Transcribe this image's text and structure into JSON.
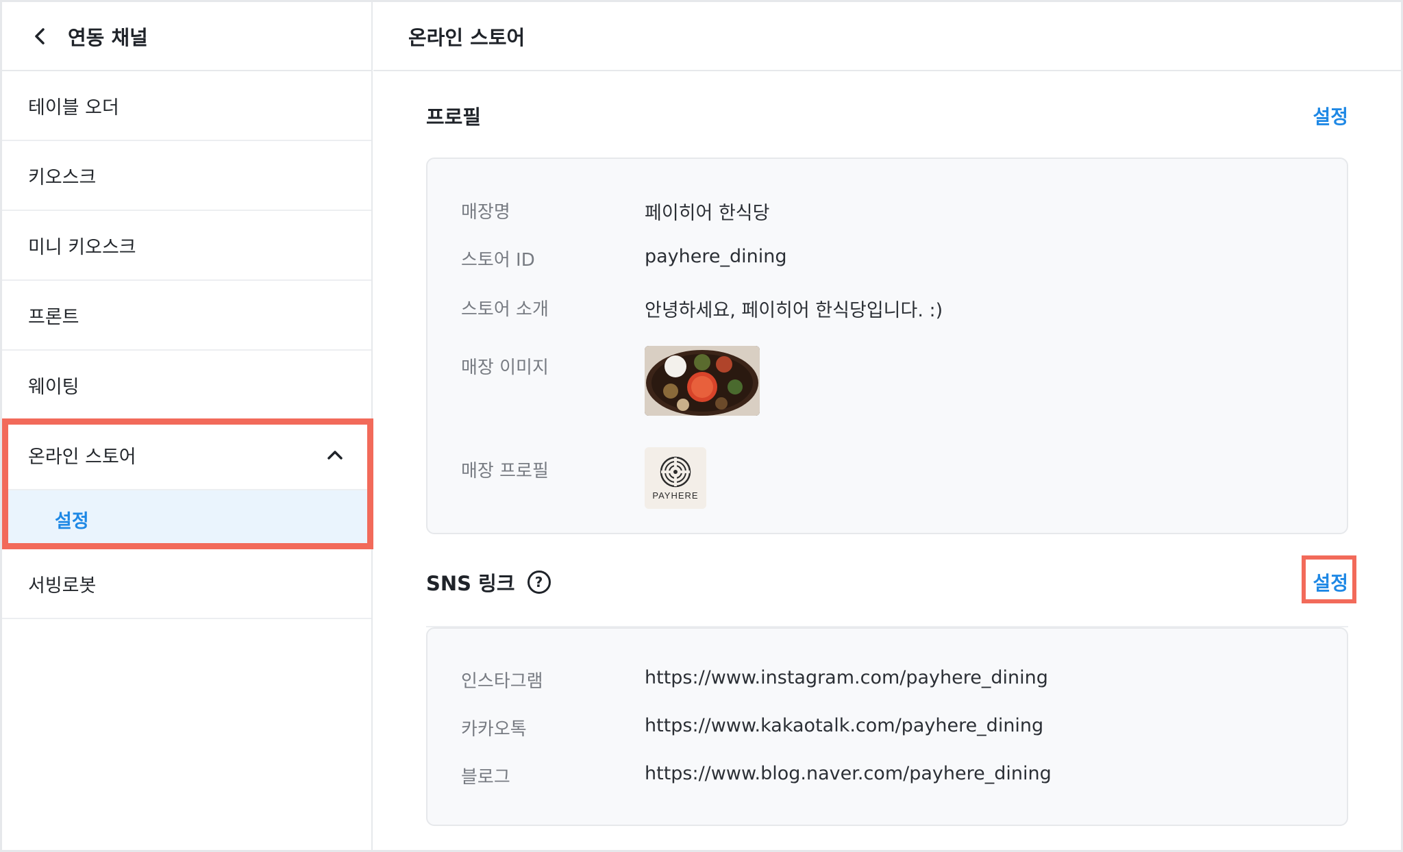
{
  "sidebar": {
    "title": "연동 채널",
    "items": [
      {
        "label": "테이블 오더"
      },
      {
        "label": "키오스크"
      },
      {
        "label": "미니 키오스크"
      },
      {
        "label": "프론트"
      },
      {
        "label": "웨이팅"
      },
      {
        "label": "온라인 스토어"
      },
      {
        "label": "서빙로봇"
      }
    ],
    "active_sub": "설정"
  },
  "main": {
    "title": "온라인 스토어",
    "profile": {
      "title": "프로필",
      "action": "설정",
      "fields": {
        "store_name_label": "매장명",
        "store_name_value": "페이히어 한식당",
        "store_id_label": "스토어 ID",
        "store_id_value": "payhere_dining",
        "intro_label": "스토어 소개",
        "intro_value": "안녕하세요, 페이히어 한식당입니다. :)",
        "image_label": "매장 이미지",
        "profile_label": "매장 프로필",
        "logo_text": "PAYHERE"
      }
    },
    "sns": {
      "title": "SNS 링크",
      "help_glyph": "?",
      "action": "설정",
      "links": [
        {
          "label": "인스타그램",
          "value": "https://www.instagram.com/payhere_dining"
        },
        {
          "label": "카카오톡",
          "value": "https://www.kakaotalk.com/payhere_dining"
        },
        {
          "label": "블로그",
          "value": "https://www.blog.naver.com/payhere_dining"
        }
      ]
    }
  },
  "colors": {
    "accent": "#1e88e5",
    "highlight": "#f26a5a",
    "active_bg": "#eaf4fd",
    "card_bg": "#f8f9fb"
  },
  "icons": [
    "back-arrow-icon",
    "chevron-up-icon",
    "help-circle-icon"
  ]
}
